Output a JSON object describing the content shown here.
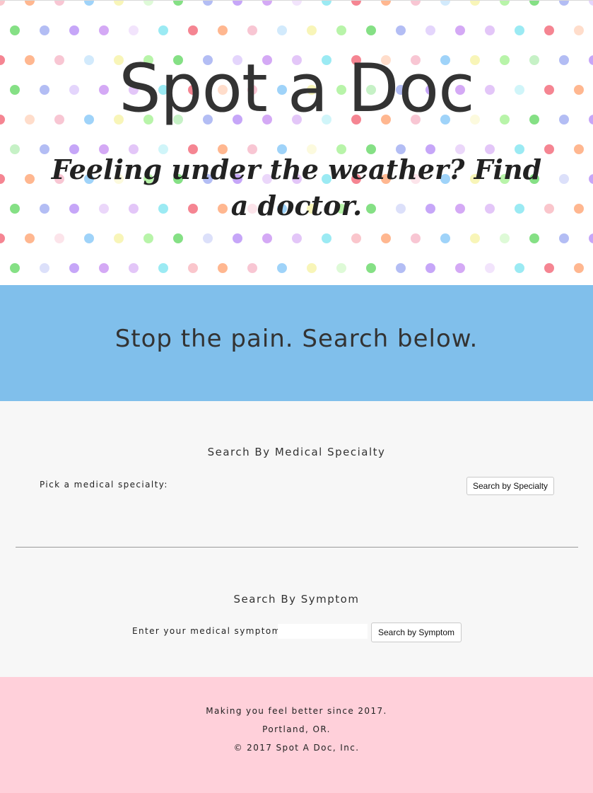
{
  "hero": {
    "title": "Spot a Doc",
    "tagline": "Feeling under the weather? Find a doctor.",
    "dot_colors": [
      "#f25c6e",
      "#9aa7f0",
      "#f6b3c4",
      "#c58cf2",
      "#f6f2a0",
      "#79e3ef",
      "#5cd65c",
      "#ff9f6b",
      "#b388f5",
      "#7fc4f7",
      "#d9b3f5",
      "#a0f08c"
    ]
  },
  "banner": {
    "text": "Stop the pain. Search below.",
    "color": "#80bfeb"
  },
  "specialty_search": {
    "title": "Search By Medical Specialty",
    "label": "Pick a medical specialty:",
    "button_label": "Search by Specialty"
  },
  "symptom_search": {
    "title": "Search By Symptom",
    "label": "Enter your medical symptom:",
    "input_value": "",
    "input_placeholder": "",
    "button_label": "Search by Symptom"
  },
  "footer": {
    "line1": "Making you feel better since 2017.",
    "line2": "Portland, OR.",
    "line3": "© 2017 Spot A Doc, Inc.",
    "color": "#ffd0da"
  }
}
